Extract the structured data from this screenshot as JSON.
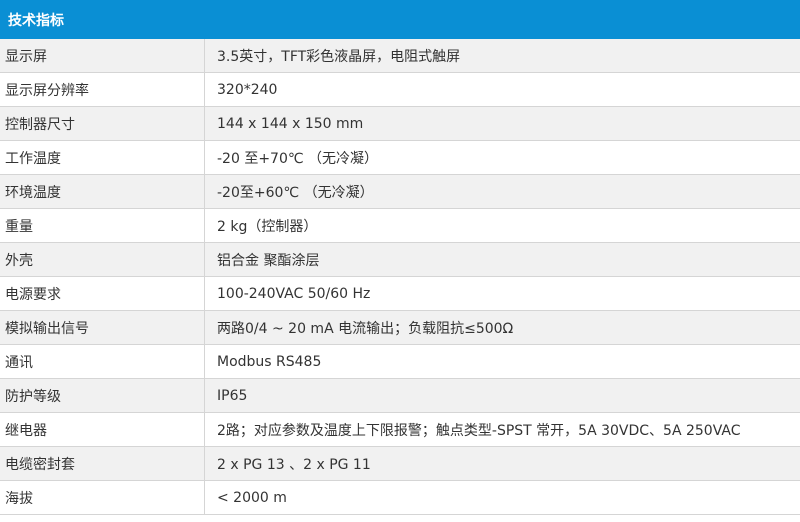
{
  "header": {
    "title": "技术指标"
  },
  "rows": [
    {
      "label": "显示屏",
      "value": "3.5英寸，TFT彩色液晶屏，电阻式触屏"
    },
    {
      "label": "显示屏分辨率",
      "value": "320*240"
    },
    {
      "label": "控制器尺寸",
      "value": "144 x 144 x 150 mm"
    },
    {
      "label": "工作温度",
      "value": "-20 至+70℃  （无冷凝）"
    },
    {
      "label": "环境温度",
      "value": "-20至+60℃  （无冷凝）"
    },
    {
      "label": "重量",
      "value": "2 kg（控制器）"
    },
    {
      "label": "外壳",
      "value": "铝合金 聚酯涂层"
    },
    {
      "label": "电源要求",
      "value": "100-240VAC 50/60 Hz"
    },
    {
      "label": "模拟输出信号",
      "value": "两路0/4 ~ 20 mA 电流输出；负载阻抗≤500Ω"
    },
    {
      "label": "通讯",
      "value": "Modbus  RS485"
    },
    {
      "label": "防护等级",
      "value": "IP65"
    },
    {
      "label": "继电器",
      "value": "2路；对应参数及温度上下限报警；触点类型-SPST 常开，5A 30VDC、5A 250VAC"
    },
    {
      "label": "电缆密封套",
      "value": "2 x PG 13 、2 x PG 11"
    },
    {
      "label": "海拔",
      "value": "< 2000 m"
    }
  ]
}
